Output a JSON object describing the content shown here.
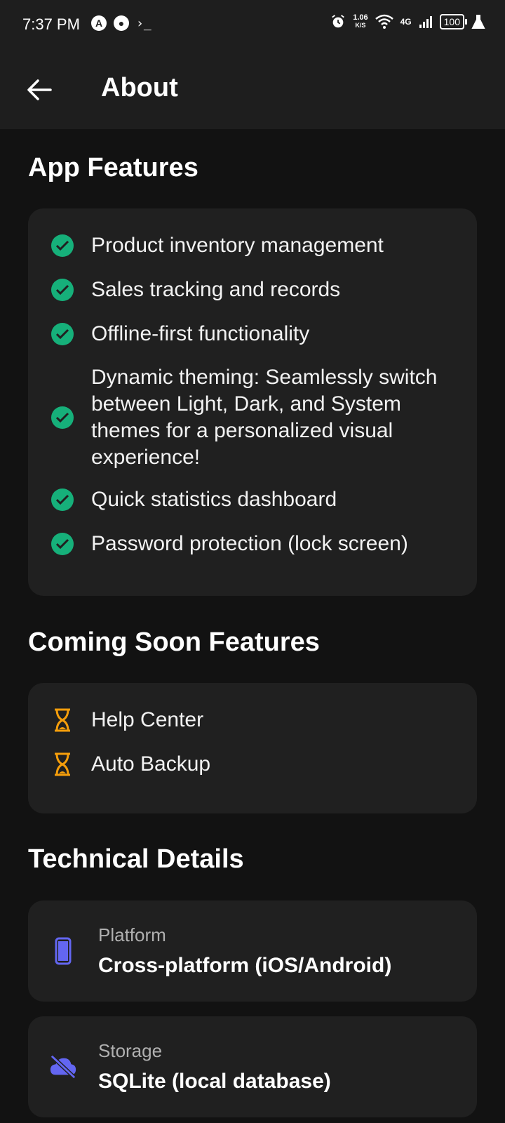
{
  "status_bar": {
    "time": "7:37 PM",
    "speed_value": "1.06",
    "speed_unit": "K/S",
    "network": "4G",
    "battery": "100",
    "terminal_glyph": "›_"
  },
  "app_bar": {
    "title": "About",
    "back_icon": "arrow-left-icon"
  },
  "app_features": {
    "title": "App Features",
    "icon": "check-circle-icon",
    "icon_color": "#16b07a",
    "items": [
      "Product inventory management",
      "Sales tracking and records",
      "Offline-first functionality",
      "Dynamic theming: Seamlessly switch between Light, Dark, and System themes for a personalized visual experience!",
      "Quick statistics dashboard",
      "Password protection (lock screen)"
    ]
  },
  "coming_soon": {
    "title": "Coming Soon Features",
    "icon": "hourglass-icon",
    "icon_color": "#f59e0b",
    "items": [
      "Help Center",
      "Auto Backup"
    ]
  },
  "technical_details": {
    "title": "Technical Details",
    "icon_color": "#6366f1",
    "items": [
      {
        "label": "Platform",
        "value": "Cross-platform (iOS/Android)",
        "icon": "smartphone-icon"
      },
      {
        "label": "Storage",
        "value": "SQLite (local database)",
        "icon": "cloud-off-icon"
      }
    ]
  }
}
